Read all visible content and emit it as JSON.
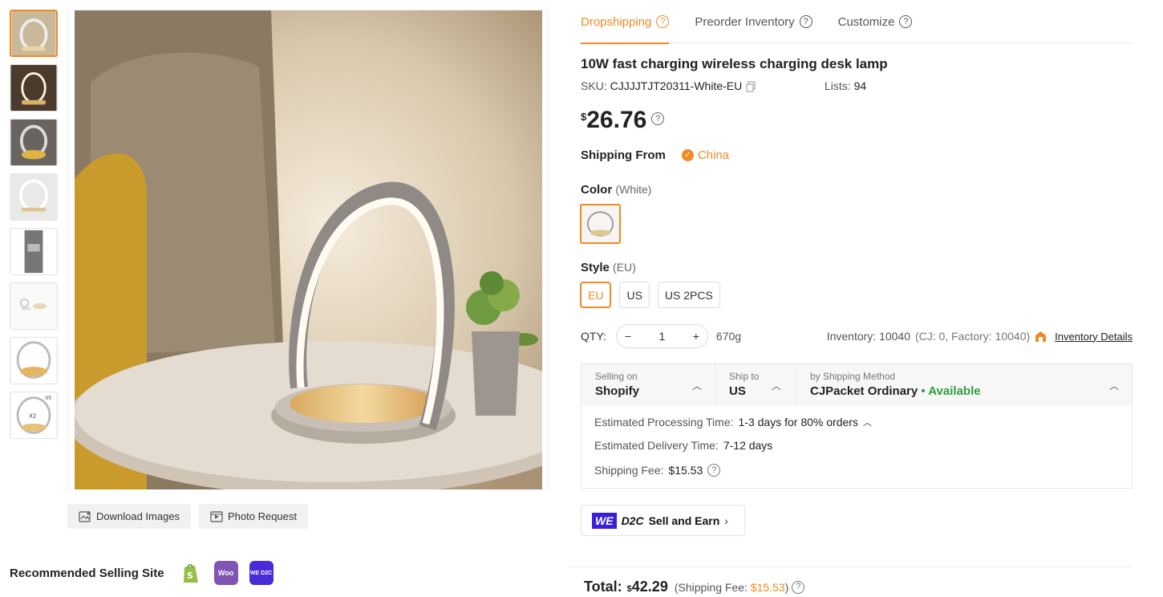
{
  "tabs": [
    {
      "label": "Dropshipping",
      "active": true
    },
    {
      "label": "Preorder Inventory",
      "active": false
    },
    {
      "label": "Customize",
      "active": false
    }
  ],
  "product": {
    "title": "10W fast charging wireless charging desk lamp",
    "sku_label": "SKU:",
    "sku": "CJJJJTJT20311-White-EU",
    "lists_label": "Lists:",
    "lists": "94",
    "currency": "$",
    "price": "26.76"
  },
  "shipping_from": {
    "label": "Shipping From",
    "country": "China"
  },
  "color": {
    "label": "Color",
    "selected": "(White)"
  },
  "style": {
    "label": "Style",
    "selected": "(EU)",
    "options": [
      "EU",
      "US",
      "US 2PCS"
    ]
  },
  "qty": {
    "label": "QTY:",
    "value": "1",
    "minus": "−",
    "plus": "+",
    "weight": "670g",
    "inventory": "Inventory: 10040",
    "inventory_sub": "(CJ: 0, Factory: 10040)",
    "details_link": "Inventory Details"
  },
  "shipping": {
    "selling_on_label": "Selling on",
    "selling_on": "Shopify",
    "ship_to_label": "Ship to",
    "ship_to": "US",
    "method_label": "by Shipping Method",
    "method": "CJPacket Ordinary",
    "availability": "• Available",
    "processing_label": "Estimated Processing Time:",
    "processing": "1-3 days for 80% orders",
    "delivery_label": "Estimated Delivery Time:",
    "delivery": "7-12 days",
    "fee_label": "Shipping Fee:",
    "fee": "$15.53"
  },
  "sell_earn": {
    "we": "WE",
    "d2c": "D2C",
    "label": "Sell and Earn"
  },
  "total": {
    "label": "Total:",
    "currency": "$",
    "amount": "42.29",
    "fee_prefix": "(Shipping Fee:",
    "fee": "$15.53",
    "fee_suffix": ")"
  },
  "image_buttons": {
    "download": "Download Images",
    "photo": "Photo Request"
  },
  "recommended": {
    "label": "Recommended Selling Site",
    "sites": [
      "shopify-icon",
      "woo-icon",
      "wed2c-icon"
    ],
    "woo_text": "Woo",
    "wed2c_text": "WE D2C"
  },
  "colors": {
    "accent": "#f08a24",
    "available": "#2e9e3e",
    "we_brand": "#3a1fd8"
  }
}
